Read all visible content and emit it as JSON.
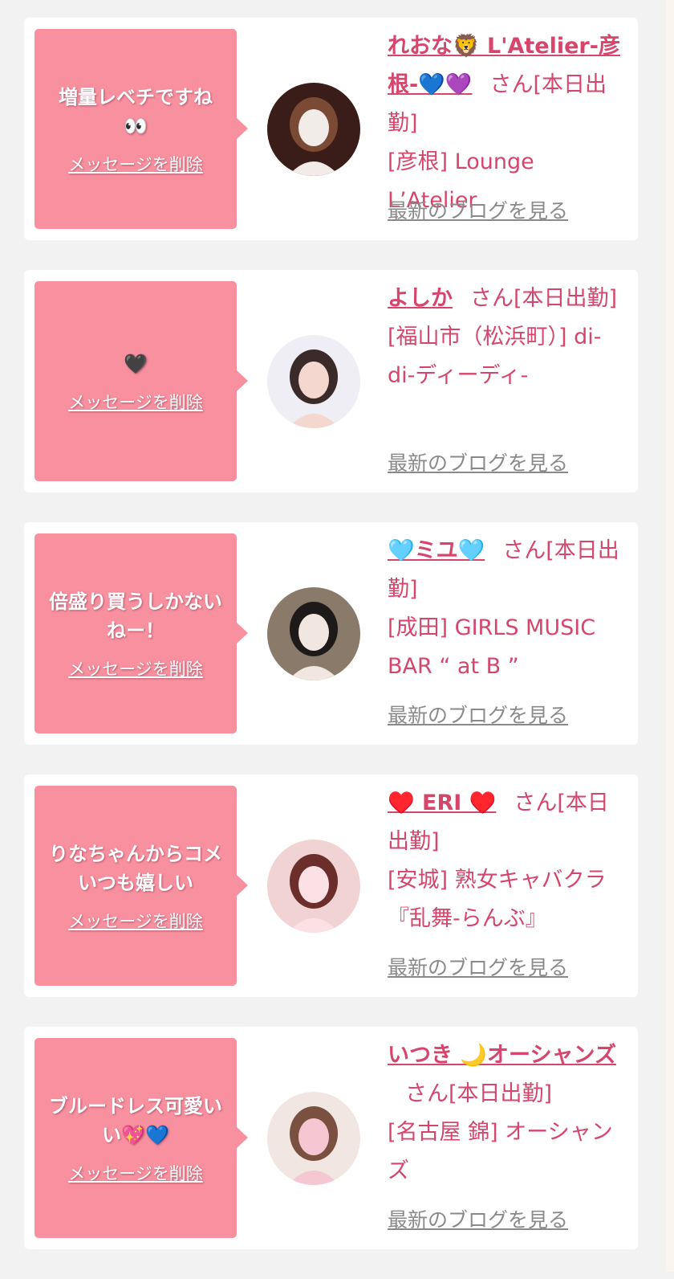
{
  "messages": [
    {
      "message": "増量レベチですね👀",
      "delete_label": "メッセージを削除",
      "name": "れおな🦁 L'Atelier-彦根-💙💜",
      "suffix": "さん[本日出勤]",
      "shop": "[彦根] Lounge L’Atelier",
      "blog_label": "最新のブログを見る",
      "avatar_palette": [
        "#3a1c18",
        "#7a4a34",
        "#f1ece8"
      ]
    },
    {
      "message": "🖤",
      "delete_label": "メッセージを削除",
      "name": "よしか",
      "suffix": "さん[本日出勤]",
      "shop": "[福山市（松浜町）] di-di-ディーディ-",
      "blog_label": "最新のブログを見る",
      "avatar_palette": [
        "#efeef5",
        "#3b2a2a",
        "#f4d8cf"
      ]
    },
    {
      "message": "倍盛り買うしかないねー！",
      "delete_label": "メッセージを削除",
      "name": "🩵ミユ🩵",
      "suffix": "さん[本日出勤]",
      "shop": "[成田] GIRLS MUSIC BAR “ at B ”",
      "blog_label": "最新のブログを見る",
      "avatar_palette": [
        "#8a7a6a",
        "#1e1a1a",
        "#f2e6e0"
      ]
    },
    {
      "message": "りなちゃんからコメいつも嬉しい",
      "delete_label": "メッセージを削除",
      "name": "♥️ ERI ♥️",
      "suffix": "さん[本日出勤]",
      "shop": "[安城] 熟女キャバクラ『乱舞-らんぶ』",
      "blog_label": "最新のブログを見る",
      "avatar_palette": [
        "#f1d3d3",
        "#6b2e2a",
        "#fbe1e6"
      ]
    },
    {
      "message": "ブルードレス可愛いい💖💙",
      "delete_label": "メッセージを削除",
      "name": "いつき 🌙オーシャンズ",
      "suffix": "さん[本日出勤]",
      "shop": "[名古屋 錦] オーシャンズ",
      "blog_label": "最新のブログを見る",
      "avatar_palette": [
        "#f2e6e2",
        "#7a5040",
        "#f4c7d2"
      ]
    }
  ]
}
